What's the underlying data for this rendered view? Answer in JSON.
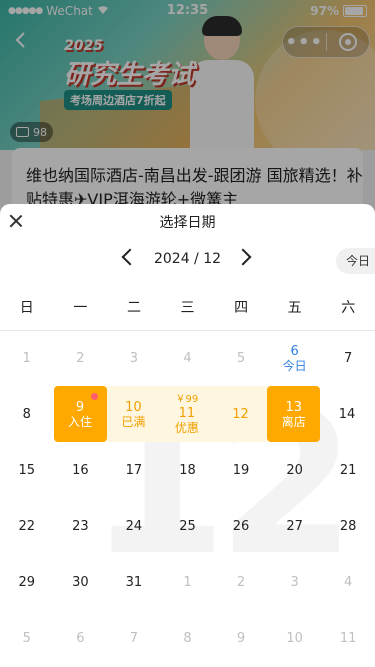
{
  "status_bar": {
    "carrier": "WeChat",
    "time": "12:35",
    "battery": "97%"
  },
  "banner": {
    "year": "2025",
    "title": "研究生考试",
    "subtitle": "考场周边酒店7折起"
  },
  "photo_count": "98",
  "product": {
    "title": "维也纳国际酒店-南昌出发-跟团游 国旅精选！补贴特惠✈VIP洱海游轮+微篝主"
  },
  "picker": {
    "title": "选择日期",
    "month_label": "2024 / 12",
    "today_button": "今日",
    "watermark": "12",
    "weekdays": [
      "日",
      "一",
      "二",
      "三",
      "四",
      "五",
      "六"
    ],
    "rows": [
      [
        {
          "day": "1",
          "dim": true
        },
        {
          "day": "2",
          "dim": true
        },
        {
          "day": "3",
          "dim": true
        },
        {
          "day": "4",
          "dim": true
        },
        {
          "day": "5",
          "dim": true
        },
        {
          "day": "6",
          "sub": "今日",
          "today": true
        },
        {
          "day": "7"
        }
      ],
      [
        {
          "day": "8"
        },
        {
          "day": "9",
          "sub": "入住",
          "endpoint": true,
          "dot": true
        },
        {
          "day": "10",
          "sub": "已满",
          "range": true
        },
        {
          "day": "11",
          "price": "￥99",
          "sub": "优惠",
          "range": true
        },
        {
          "day": "12",
          "range": true
        },
        {
          "day": "13",
          "sub": "离店",
          "endpoint": true
        },
        {
          "day": "14"
        }
      ],
      [
        {
          "day": "15"
        },
        {
          "day": "16"
        },
        {
          "day": "17"
        },
        {
          "day": "18"
        },
        {
          "day": "19"
        },
        {
          "day": "20"
        },
        {
          "day": "21"
        }
      ],
      [
        {
          "day": "22"
        },
        {
          "day": "23"
        },
        {
          "day": "24"
        },
        {
          "day": "25"
        },
        {
          "day": "26"
        },
        {
          "day": "27"
        },
        {
          "day": "28"
        }
      ],
      [
        {
          "day": "29"
        },
        {
          "day": "30"
        },
        {
          "day": "31"
        },
        {
          "day": "1",
          "dim": true
        },
        {
          "day": "2",
          "dim": true
        },
        {
          "day": "3",
          "dim": true
        },
        {
          "day": "4",
          "dim": true
        }
      ],
      [
        {
          "day": "5",
          "dim": true
        },
        {
          "day": "6",
          "dim": true
        },
        {
          "day": "7",
          "dim": true
        },
        {
          "day": "8",
          "dim": true
        },
        {
          "day": "9",
          "dim": true
        },
        {
          "day": "10",
          "dim": true
        },
        {
          "day": "11",
          "dim": true
        }
      ]
    ]
  },
  "colors": {
    "accent": "#FFA800",
    "range_bg": "#FFF6E0",
    "today": "#2F7FE0",
    "dot": "#FF5C6C"
  }
}
